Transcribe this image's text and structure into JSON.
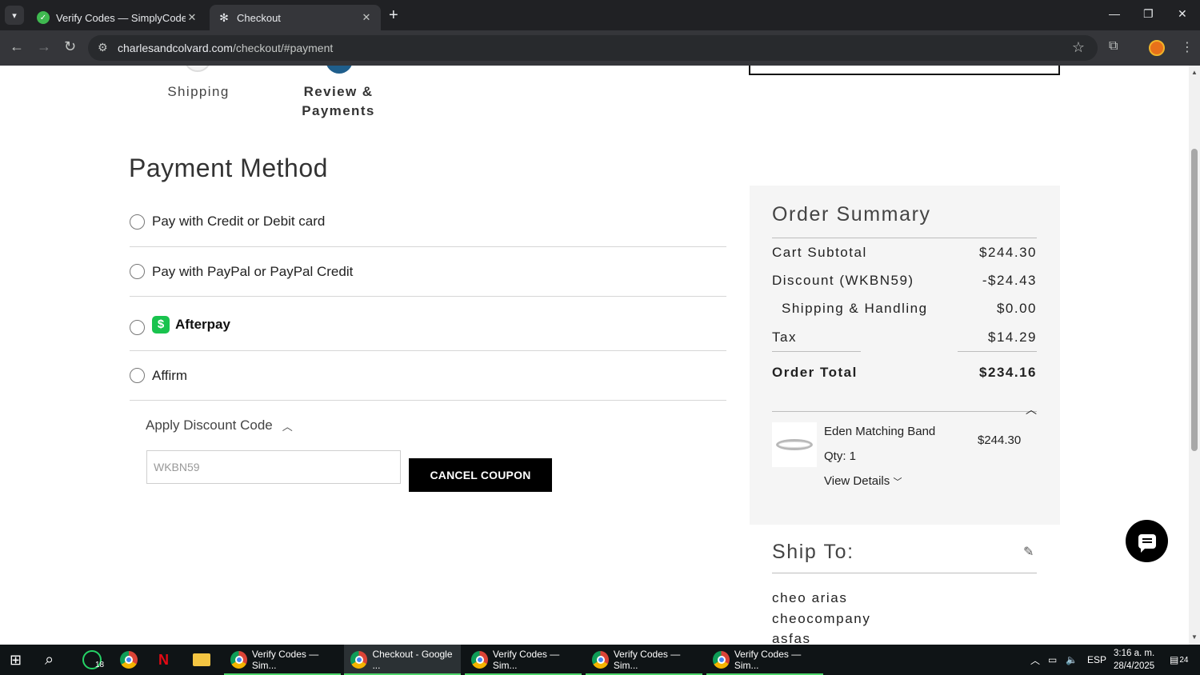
{
  "browser": {
    "tabs": [
      {
        "title": "Verify Codes — SimplyCodes",
        "active": false
      },
      {
        "title": "Checkout",
        "active": true
      }
    ],
    "url_domain": "charlesandcolvard.com",
    "url_path": "/checkout/#payment"
  },
  "steps": {
    "shipping": "Shipping",
    "review_line1": "Review &",
    "review_line2": "Payments"
  },
  "payment": {
    "title": "Payment Method",
    "options": [
      {
        "label": "Pay with Credit or Debit card"
      },
      {
        "label": "Pay with PayPal or PayPal Credit"
      },
      {
        "label": "Afterpay",
        "logo_glyph": "$",
        "logo_color": "#19c34e"
      },
      {
        "label": "Affirm"
      }
    ],
    "discount_toggle": "Apply Discount Code",
    "coupon_value": "WKBN59",
    "cancel_button": "CANCEL COUPON"
  },
  "summary": {
    "title": "Order Summary",
    "rows": [
      {
        "label": "Cart Subtotal",
        "value": "$244.30"
      },
      {
        "label": "Discount (WKBN59)",
        "value": "-$24.43"
      },
      {
        "label": "Shipping & Handling",
        "value": "$0.00"
      },
      {
        "label": "Tax",
        "value": "$14.29"
      }
    ],
    "total_label": "Order Total",
    "total_value": "$234.16",
    "item": {
      "name": "Eden Matching Band",
      "qty": "Qty: 1",
      "details": "View Details",
      "price": "$244.30"
    }
  },
  "ship_to": {
    "title": "Ship To:",
    "lines": [
      "cheo arias",
      "cheocompany",
      "asfas"
    ]
  },
  "taskbar": {
    "apps": [
      {
        "label": "Verify Codes — Sim...",
        "active": false
      },
      {
        "label": "Checkout - Google ...",
        "active": true
      },
      {
        "label": "Verify Codes — Sim...",
        "active": false
      },
      {
        "label": "Verify Codes — Sim...",
        "active": false
      },
      {
        "label": "Verify Codes — Sim...",
        "active": false
      }
    ],
    "whatsapp_badge": "18",
    "language": "ESP",
    "time": "3:16 a. m.",
    "date": "28/4/2025",
    "notifications": "24"
  },
  "colors": {
    "accent_step": "#1f5e8c",
    "summary_bg": "#f5f5f5",
    "button_bg": "#000000"
  }
}
